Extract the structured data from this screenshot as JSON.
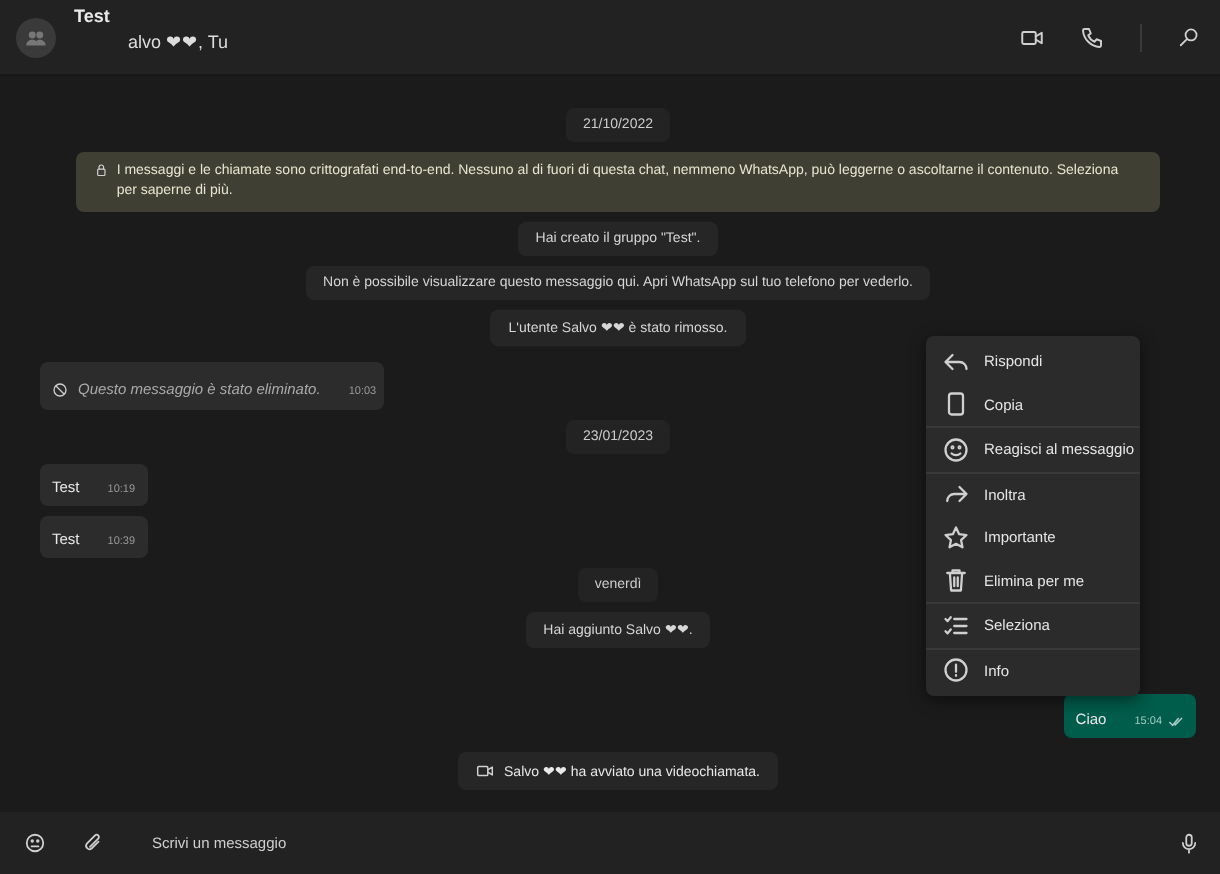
{
  "header": {
    "title": "Test",
    "subtitle": "alvo ❤❤, Tu"
  },
  "messages": [
    {
      "kind": "date",
      "text": "21/10/2022"
    },
    {
      "kind": "notice",
      "text": "I messaggi e le chiamate sono crittografati end-to-end. Nessuno al di fuori di questa chat, nemmeno WhatsApp, può leggerne o ascoltarne il contenuto. Seleziona per saperne di più."
    },
    {
      "kind": "system",
      "text": "Hai creato il gruppo \"Test\"."
    },
    {
      "kind": "system",
      "text": "Non è possibile visualizzare questo messaggio qui. Apri WhatsApp sul tuo telefono per vederlo."
    },
    {
      "kind": "system",
      "text": "L'utente Salvo ❤❤ è stato rimosso."
    },
    {
      "kind": "deleted",
      "text": "Questo messaggio è stato eliminato.",
      "time": "10:03"
    },
    {
      "kind": "date",
      "text": "23/01/2023"
    },
    {
      "kind": "incoming",
      "text": "Test",
      "time": "10:19"
    },
    {
      "kind": "incoming",
      "text": "Test",
      "time": "10:39"
    },
    {
      "kind": "date",
      "text": "venerdì"
    },
    {
      "kind": "system",
      "text": "Hai aggiunto Salvo ❤❤."
    },
    {
      "kind": "outgoing",
      "text": "Ciao",
      "time": "15:04"
    },
    {
      "kind": "call",
      "text": "Salvo ❤❤ ha avviato una videochiamata."
    }
  ],
  "context_menu": {
    "groups": [
      [
        "Rispondi",
        "Copia"
      ],
      [
        "Reagisci al messaggio"
      ],
      [
        "Inoltra",
        "Importante",
        "Elimina per me"
      ],
      [
        "Seleziona"
      ],
      [
        "Info"
      ]
    ]
  },
  "composer": {
    "placeholder": "Scrivi un messaggio"
  }
}
